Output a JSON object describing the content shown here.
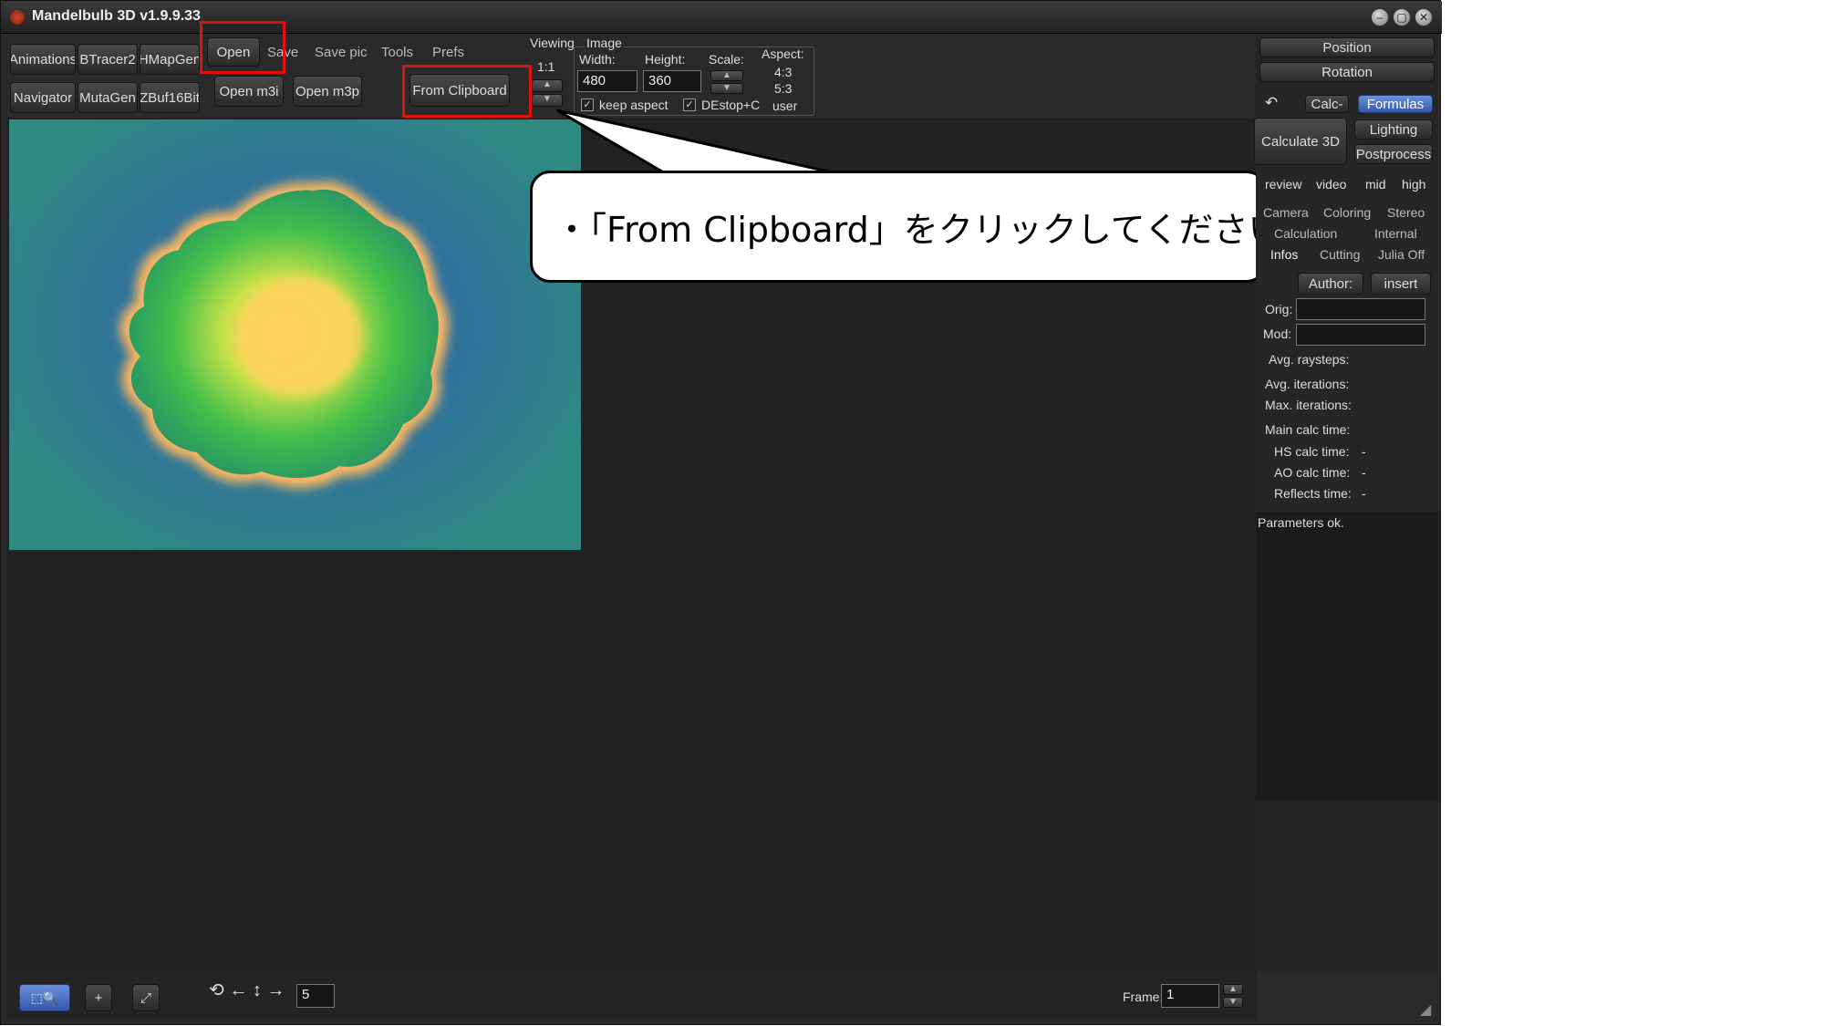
{
  "window": {
    "title": "Mandelbulb 3D   v1.9.9.33",
    "controls": [
      "minimize",
      "restore",
      "close"
    ]
  },
  "toolbar": {
    "left_buttons": [
      "Animations",
      "BTracer2",
      "HMapGen",
      "Navigator",
      "MutaGen",
      "ZBuf16Bit"
    ],
    "menu": [
      "Open",
      "Save",
      "Save pic",
      "Tools",
      "Prefs"
    ],
    "open_m3i": "Open m3i",
    "open_m3p": "Open m3p",
    "from_clipboard": "From Clipboard"
  },
  "viewing": {
    "label": "Viewing",
    "ratio": "1:1"
  },
  "image": {
    "label": "Image",
    "width_label": "Width:",
    "width_value": "480",
    "height_label": "Height:",
    "height_value": "360",
    "scale_label": "Scale:",
    "aspect_label": "Aspect:",
    "aspect_options": [
      "4:3",
      "5:3",
      "user"
    ],
    "keep_aspect": "keep aspect",
    "destop": "DEstop+C"
  },
  "callout": {
    "text": "・「From Clipboard」をクリックしてください"
  },
  "right_panel": {
    "position": "Position",
    "rotation": "Rotation",
    "calc": "Calc-",
    "formulas": "Formulas",
    "calculate3d": "Calculate 3D",
    "lighting": "Lighting",
    "postprocess": "Postprocess",
    "quality": [
      "review",
      "video",
      "mid",
      "high"
    ],
    "tabs_row1": [
      "Camera",
      "Coloring",
      "Stereo"
    ],
    "tabs_row2": [
      "Calculation",
      "Internal"
    ],
    "tabs_row3": [
      "Infos",
      "Cutting",
      "Julia Off"
    ],
    "author": "Author:",
    "insert": "insert",
    "orig": "Orig:",
    "mod": "Mod:",
    "avg_raysteps": "Avg. raysteps:",
    "avg_iterations": "Avg. iterations:",
    "max_iterations": "Max. iterations:",
    "main_calc_time": "Main calc time:",
    "hs_calc_time": "HS calc time:",
    "hs_value": "-",
    "ao_calc_time": "AO calc time:",
    "ao_value": "-",
    "reflects_time": "Reflects time:",
    "reflects_value": "-",
    "status": "Parameters ok."
  },
  "bottom": {
    "step_value": "5",
    "frame_label": "Frame:",
    "frame_value": "1"
  },
  "colors": {
    "highlight_red": "#e01010",
    "accent_blue": "#3359b0",
    "background": "#2a2a2a"
  }
}
